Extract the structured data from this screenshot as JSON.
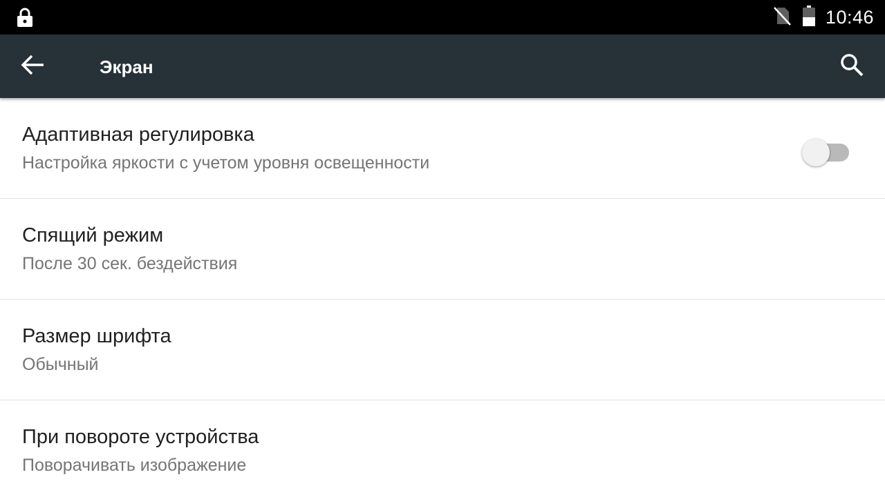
{
  "status_bar": {
    "time": "10:46",
    "icons": [
      "lock-icon",
      "no-sim-icon",
      "battery-icon"
    ]
  },
  "toolbar": {
    "title": "Экран",
    "back_icon": "arrow-back-icon",
    "search_icon": "search-icon",
    "background": "#263238"
  },
  "settings": [
    {
      "title": "Адаптивная регулировка",
      "summary": "Настройка яркости с учетом уровня освещенности",
      "toggle": false
    },
    {
      "title": "Спящий режим",
      "summary": "После 30 сек. бездействия"
    },
    {
      "title": "Размер шрифта",
      "summary": "Обычный"
    },
    {
      "title": "При повороте устройства",
      "summary": "Поворачивать изображение"
    }
  ]
}
